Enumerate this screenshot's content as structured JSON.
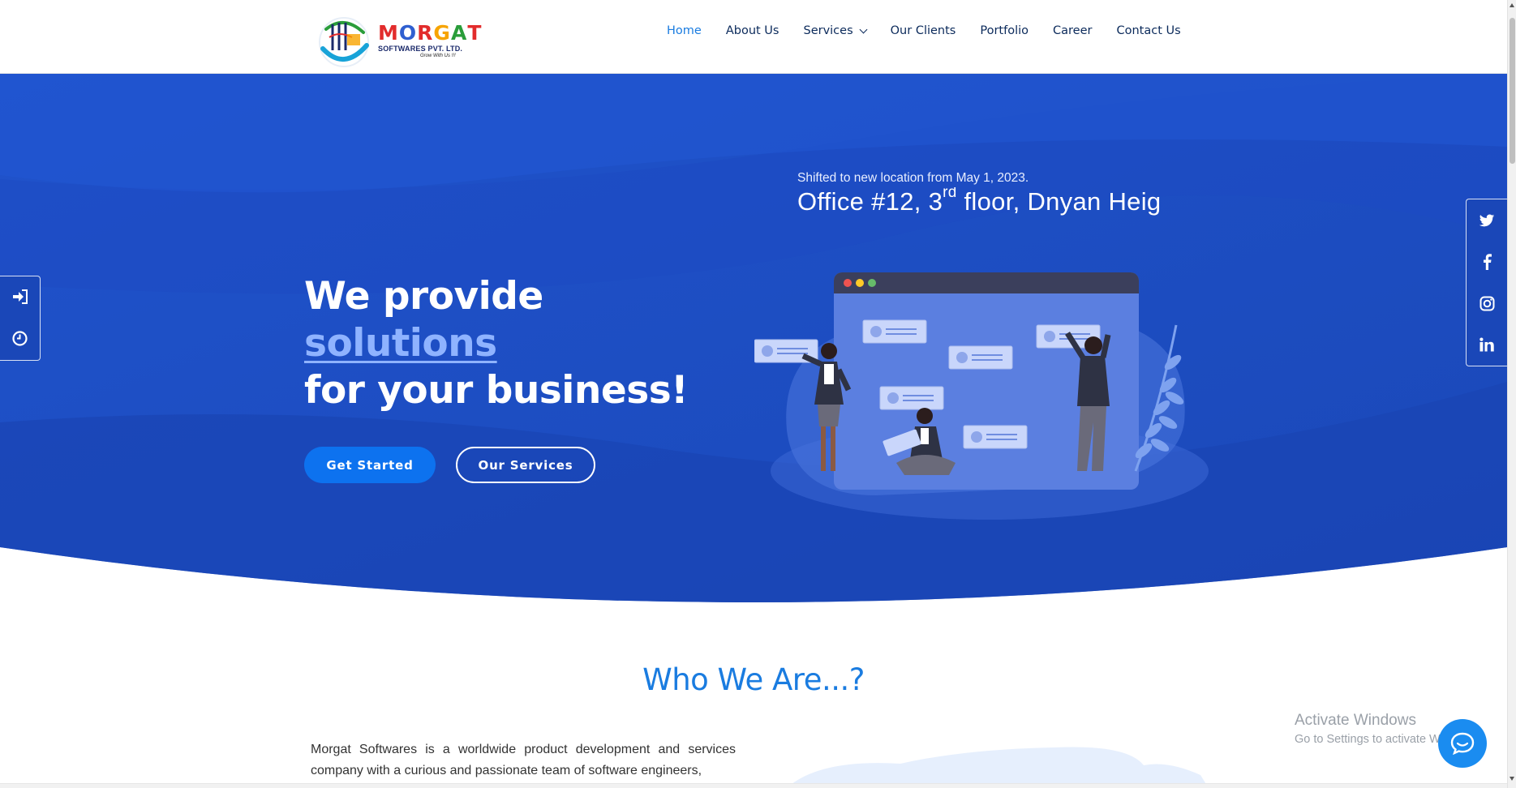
{
  "logo": {
    "name_letters": [
      "M",
      "O",
      "R",
      "G",
      "A",
      "T"
    ],
    "name_colors": [
      "#e22c2c",
      "#2f5fd0",
      "#e22c2c",
      "#f7a400",
      "#2a9d3a",
      "#e22c2c"
    ],
    "subtitle": "SOFTWARES PVT. LTD.",
    "tagline": "Grow With Us !!!"
  },
  "nav": {
    "items": [
      {
        "label": "Home",
        "active": true
      },
      {
        "label": "About Us"
      },
      {
        "label": "Services",
        "has_dropdown": true
      },
      {
        "label": "Our Clients"
      },
      {
        "label": "Portfolio"
      },
      {
        "label": "Career"
      },
      {
        "label": "Contact Us"
      }
    ]
  },
  "notice": {
    "small": "Shifted to new location from May 1, 2023.",
    "big_prefix": "Office #12, 3",
    "big_sup": "rd",
    "big_suffix": " floor, Dnyan Heig"
  },
  "hero": {
    "line1": "We provide",
    "line2": "solutions",
    "line3": "for your business!",
    "primary_button": "Get Started",
    "secondary_button": "Our Services"
  },
  "side_left": {
    "icons": [
      "sign-in-icon",
      "clock-icon"
    ]
  },
  "side_right": {
    "icons": [
      "twitter-icon",
      "facebook-icon",
      "instagram-icon",
      "linkedin-icon"
    ]
  },
  "who": {
    "title": "Who We Are...?",
    "text": "Morgat Softwares is a worldwide product development and services company with a curious and passionate team of software engineers,"
  },
  "watermark": {
    "line1": "Activate Windows",
    "line2": "Go to Settings to activate Windows."
  },
  "colors": {
    "hero_bg": "#1c4ec5",
    "accent_blue": "#1a7ce0",
    "button_blue": "#0d72ef",
    "nav_text": "#0b2a5b"
  }
}
